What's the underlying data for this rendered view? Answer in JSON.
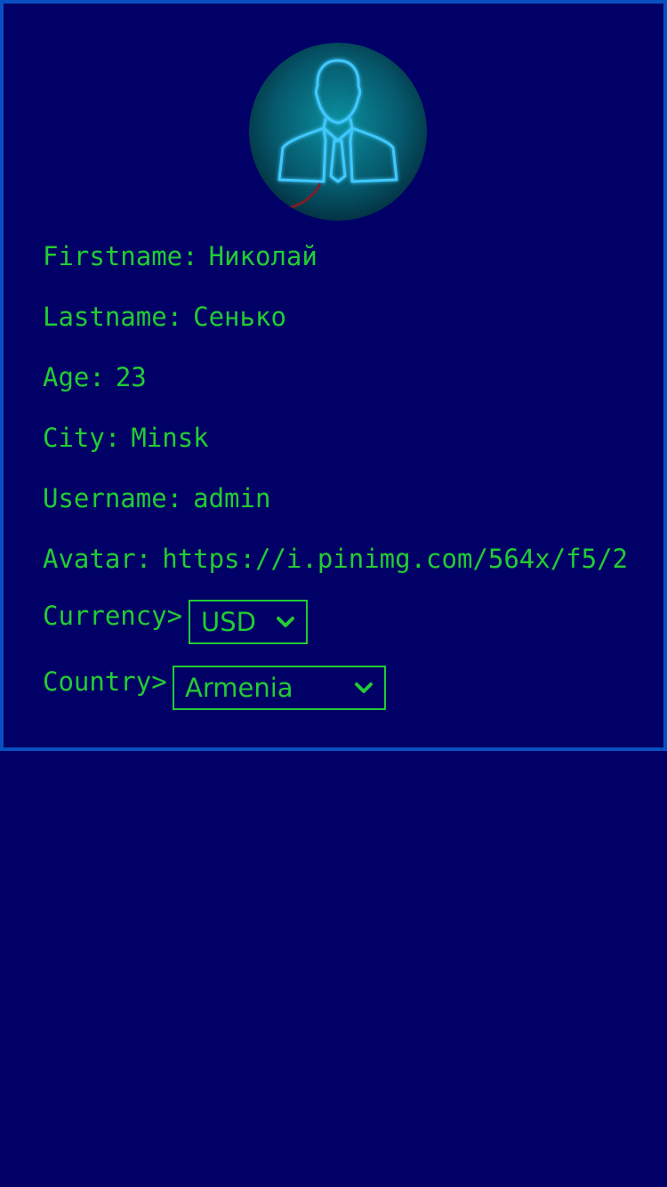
{
  "profile": {
    "avatar_icon": "businessman-neon-icon",
    "fields": {
      "firstname": {
        "label": "Firstname:",
        "value": "Николай"
      },
      "lastname": {
        "label": "Lastname:",
        "value": "Сенько"
      },
      "age": {
        "label": "Age:",
        "value": "23"
      },
      "city": {
        "label": "City:",
        "value": "Minsk"
      },
      "username": {
        "label": "Username:",
        "value": "admin"
      },
      "avatar": {
        "label": "Avatar:",
        "value": "https://i.pinimg.com/564x/f5/2"
      }
    },
    "currency": {
      "label": "Currency>",
      "selected": "USD"
    },
    "country": {
      "label": "Country>",
      "selected": "Armenia"
    }
  },
  "colors": {
    "background": "#000066",
    "border": "#0a4fc2",
    "text": "#22cc33",
    "neon": "#3fc8ff"
  }
}
